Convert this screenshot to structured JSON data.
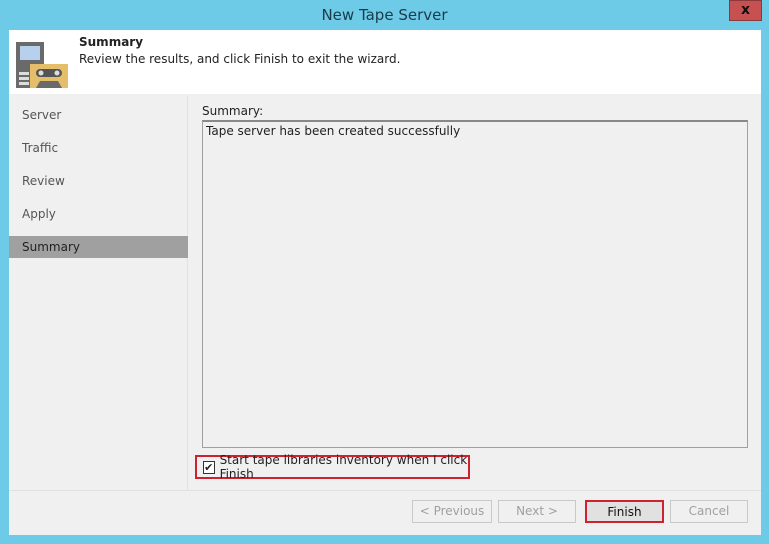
{
  "window": {
    "title": "New Tape Server",
    "close_label": "x"
  },
  "header": {
    "title": "Summary",
    "subtitle": "Review the results, and click Finish to exit the wizard.",
    "icon": "tape-server-icon"
  },
  "nav": {
    "items": [
      {
        "label": "Server"
      },
      {
        "label": "Traffic"
      },
      {
        "label": "Review"
      },
      {
        "label": "Apply"
      },
      {
        "label": "Summary",
        "selected": true
      }
    ]
  },
  "main": {
    "summary_label": "Summary:",
    "summary_text": "Tape server has been created successfully",
    "checkbox": {
      "label": "Start tape libraries inventory when I click Finish",
      "checked": true,
      "mark": "✔"
    }
  },
  "buttons": {
    "previous": "< Previous",
    "next": "Next >",
    "finish": "Finish",
    "cancel": "Cancel"
  },
  "colors": {
    "titlebar": "#6dcbe8",
    "highlight": "#d0222e",
    "selected_nav": "#a0a0a0"
  }
}
